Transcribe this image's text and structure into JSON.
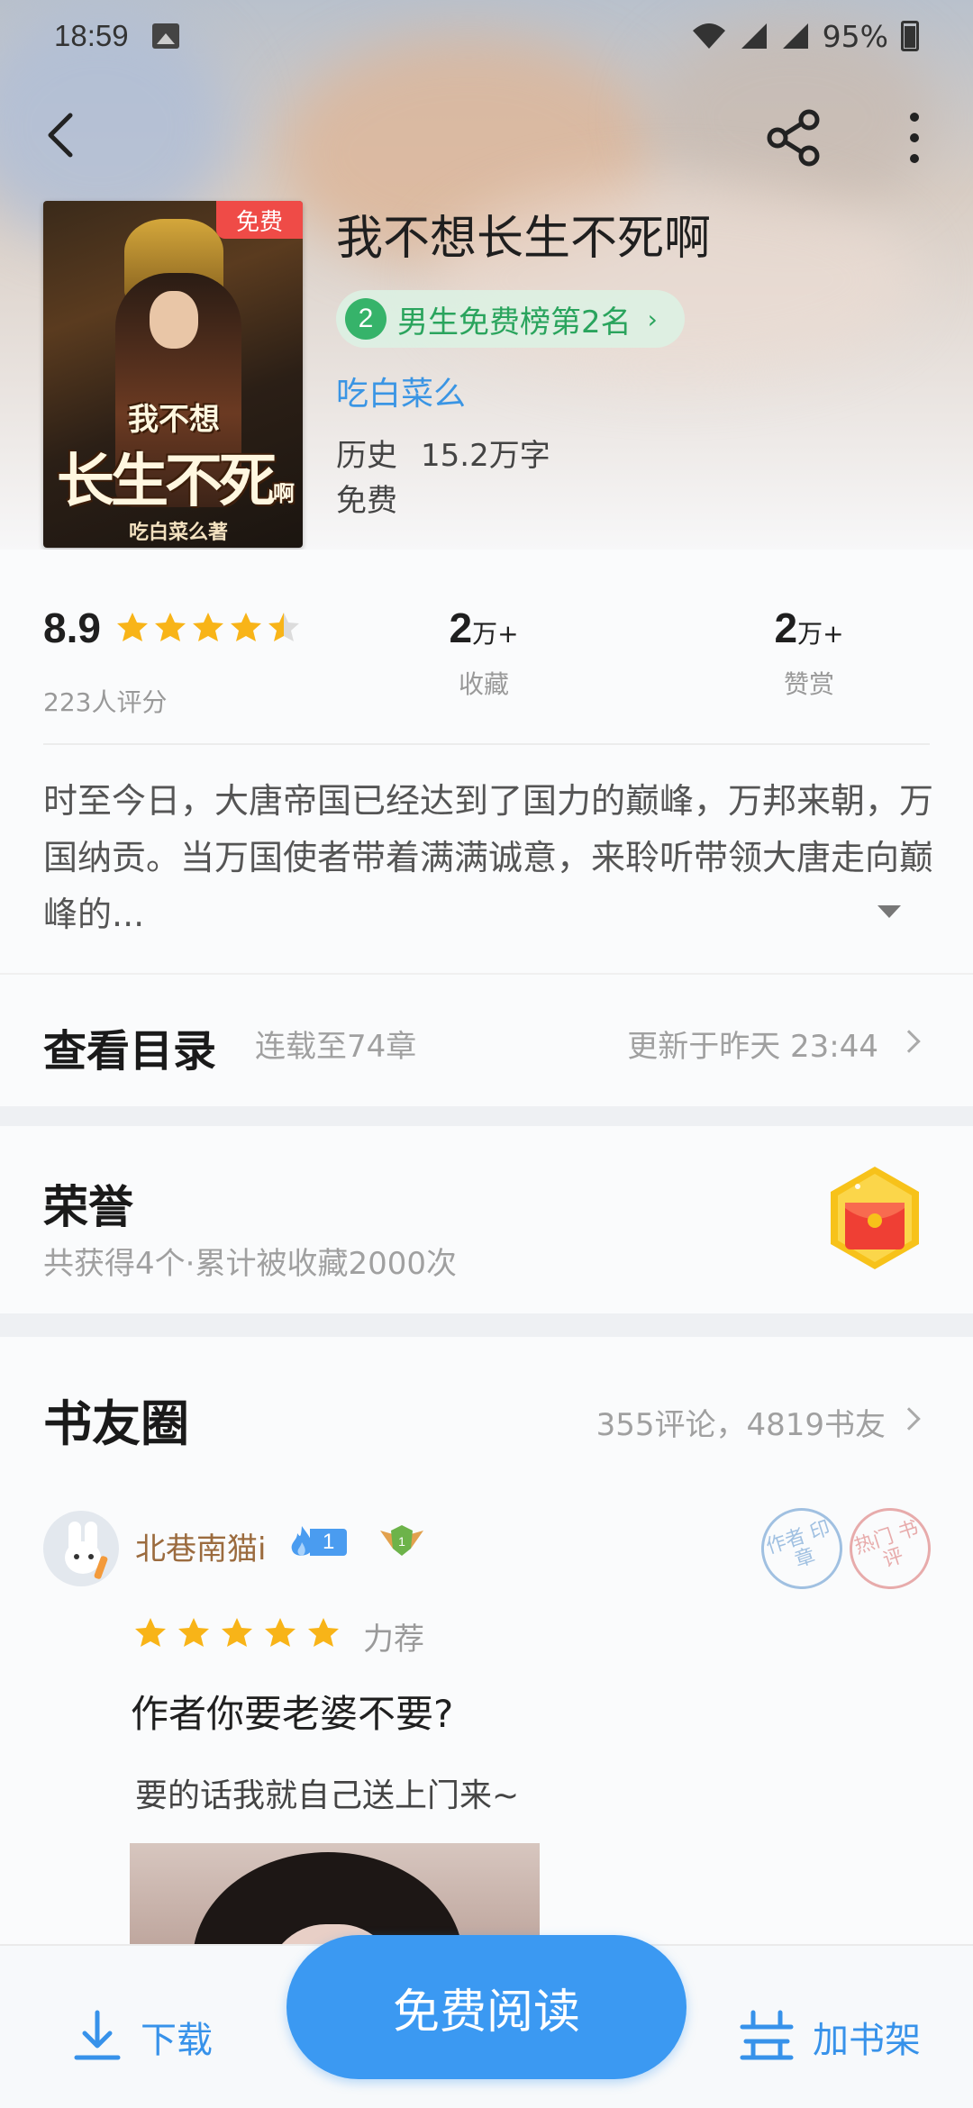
{
  "status": {
    "time": "18:59",
    "battery": "95%"
  },
  "colors": {
    "accent": "#3b99f2",
    "rank_green": "#36b36a",
    "star": "#f8b418",
    "free_tag": "#ef4b47",
    "author": "#3a95e4"
  },
  "book": {
    "cover_tag": "免费",
    "cover_title_line1": "我不想",
    "cover_title_line2": "长生不死",
    "cover_title_suffix": "啊",
    "cover_author": "吃白菜么著",
    "title": "我不想长生不死啊",
    "rank_number": "2",
    "rank_text": "男生免费榜第2名",
    "author": "吃白菜么",
    "genre": "历史",
    "word_count": "15.2万字",
    "price": "免费"
  },
  "stats": {
    "score": "8.9",
    "stars": 4.5,
    "rating_count": "223人评分",
    "favorites_value": "2",
    "favorites_unit": "万+",
    "favorites_label": "收藏",
    "rewards_value": "2",
    "rewards_unit": "万+",
    "rewards_label": "赞赏"
  },
  "description": "时至今日，大唐帝国已经达到了国力的巅峰，万邦来朝，万国纳贡。当万国使者带着满满诚意，来聆听带领大唐走向巅峰的...",
  "catalog": {
    "title": "查看目录",
    "progress": "连载至74章",
    "updated": "更新于昨天 23:44"
  },
  "honor": {
    "title": "荣誉",
    "summary": "共获得4个·累计被收藏2000次"
  },
  "circle": {
    "title": "书友圈",
    "counts": "355评论，4819书友",
    "review": {
      "username": "北巷南猫i",
      "level": "1",
      "wing_level": "1",
      "stamp_author": "作者 印章",
      "stamp_hot": "热门 书评",
      "stars": 5,
      "tag": "力荐",
      "title": "作者你要老婆不要?",
      "body": "要的话我就自己送上门来~"
    }
  },
  "bottom": {
    "download": "下载",
    "read": "免费阅读",
    "shelf": "加书架"
  }
}
